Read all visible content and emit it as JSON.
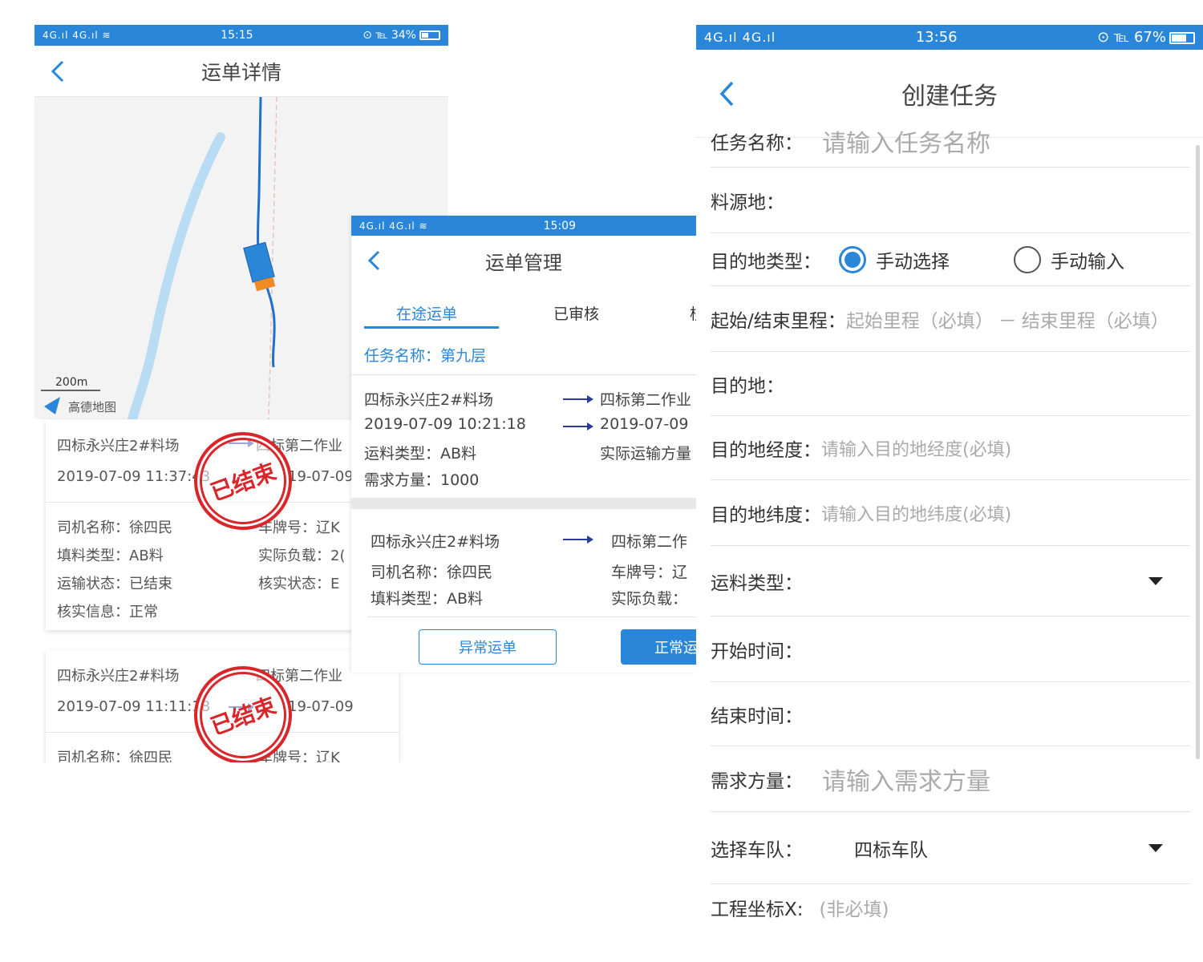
{
  "screen1": {
    "status": {
      "signal": "4G.ıl 4G.ıl ≋",
      "time": "15:15",
      "right": "⊙ ℡ 34%"
    },
    "title": "运单详情",
    "map": {
      "scale": "200m",
      "logo": "高德地图"
    },
    "cards": [
      {
        "from": "四标永兴庄2#料场",
        "to": "四标第二作业",
        "start_time": "2019-07-09 11:37:43",
        "end_time": "19-07-09",
        "stamp": "已结束",
        "driver": "司机名称：徐四民",
        "plate": "车牌号：辽K",
        "fill_type": "填料类型：AB料",
        "load": "实际负载：2(",
        "transport_status": "运输状态：已结束",
        "verify_status": "核实状态：E",
        "verify_info": "核实信息：正常"
      },
      {
        "from": "四标永兴庄2#料场",
        "to": "四标第二作业",
        "start_time": "2019-07-09 11:11:18",
        "end_time": "19-07-09",
        "stamp": "已结束",
        "driver": "司机名称：徐四民",
        "plate": "车牌号：辽K"
      }
    ]
  },
  "screen2": {
    "status": {
      "signal": "4G.ıl 4G.ıl ≋",
      "time": "15:09"
    },
    "title": "运单管理",
    "tabs": [
      "在途运单",
      "已审核",
      "核"
    ],
    "task_name": "任务名称：第九层",
    "order1": {
      "from": "四标永兴庄2#料场",
      "to": "四标第二作业",
      "start_time": "2019-07-09 10:21:18",
      "end_time": "2019-07-09",
      "type": "运料类型：AB料",
      "actual": "实际运输方量",
      "demand": "需求方量：1000"
    },
    "order2": {
      "from": "四标永兴庄2#料场",
      "to": "四标第二作",
      "driver": "司机名称：徐四民",
      "plate": "车牌号：辽",
      "fill_type": "填料类型：AB料",
      "load": "实际负载："
    },
    "buttons": {
      "abnormal": "异常运单",
      "normal": "正常运"
    }
  },
  "screen3": {
    "status": {
      "signal": "4G.ıl 4G.ıl",
      "time": "13:56",
      "right": "⊙ ℡ 67%"
    },
    "title": "创建任务",
    "fields": {
      "task_name": {
        "label": "任务名称：",
        "placeholder": "请输入任务名称"
      },
      "source": {
        "label": "料源地："
      },
      "dest_type": {
        "label": "目的地类型：",
        "options": [
          "手动选择",
          "手动输入"
        ],
        "selected": "手动选择"
      },
      "mileage": {
        "label": "起始/结束里程：",
        "start_placeholder": "起始里程（必填）",
        "dash": "－",
        "end_placeholder": "结束里程（必填）"
      },
      "dest": {
        "label": "目的地："
      },
      "lng": {
        "label": "目的地经度：",
        "placeholder": "请输入目的地经度(必填)"
      },
      "lat": {
        "label": "目的地纬度：",
        "placeholder": "请输入目的地纬度(必填)"
      },
      "material_type": {
        "label": "运料类型："
      },
      "start_time": {
        "label": "开始时间："
      },
      "end_time": {
        "label": "结束时间："
      },
      "demand": {
        "label": "需求方量：",
        "placeholder": "请输入需求方量"
      },
      "fleet": {
        "label": "选择车队：",
        "value": "四标车队"
      },
      "coord_x": {
        "label": "工程坐标X:",
        "placeholder": "(非必填)"
      }
    }
  },
  "colors": {
    "accent": "#2a86d8",
    "stamp": "#d9262b",
    "arrow": "#2a3b9a"
  }
}
